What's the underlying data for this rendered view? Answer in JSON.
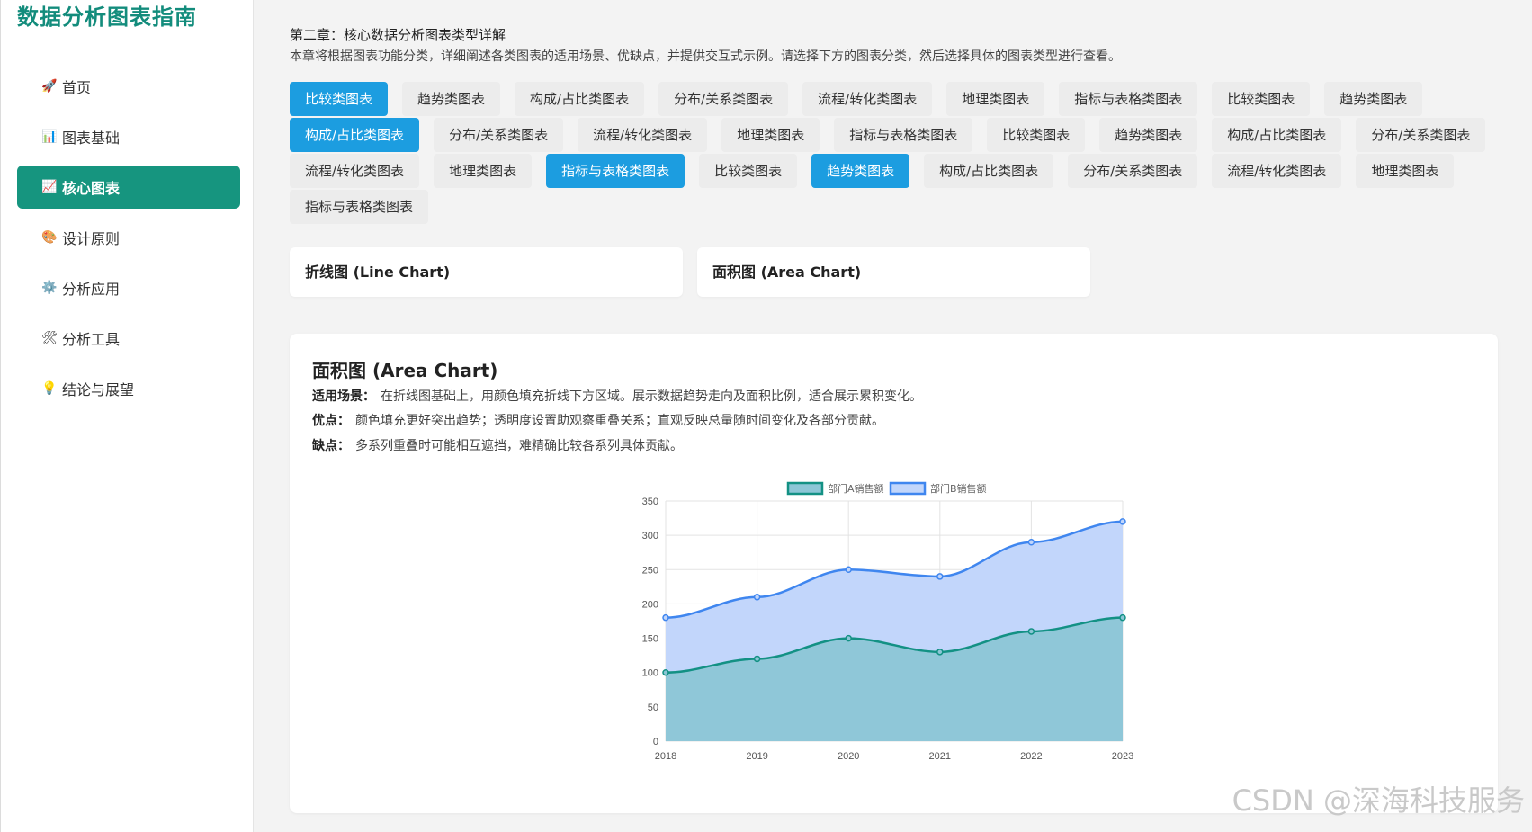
{
  "brand": {
    "title": "数据分析图表指南"
  },
  "nav": [
    {
      "icon": "🚀",
      "label": "首页",
      "active": false
    },
    {
      "icon": "📊",
      "label": "图表基础",
      "active": false
    },
    {
      "icon": "📈",
      "label": "核心图表",
      "active": true
    },
    {
      "icon": "🎨",
      "label": "设计原则",
      "active": false
    },
    {
      "icon": "⚙️",
      "label": "分析应用",
      "active": false
    },
    {
      "icon": "🛠",
      "label": "分析工具",
      "active": false
    },
    {
      "icon": "💡",
      "label": "结论与展望",
      "active": false
    }
  ],
  "chapter": {
    "title": "第二章：核心数据分析图表类型详解",
    "description": "本章将根据图表功能分类，详细阐述各类图表的适用场景、优缺点，并提供交互式示例。请选择下方的图表分类，然后选择具体的图表类型进行查看。"
  },
  "tabs": [
    {
      "label": "比较类图表",
      "active": true
    },
    {
      "label": "趋势类图表",
      "active": false
    },
    {
      "label": "构成/占比类图表",
      "active": false
    },
    {
      "label": "分布/关系类图表",
      "active": false
    },
    {
      "label": "流程/转化类图表",
      "active": false
    },
    {
      "label": "地理类图表",
      "active": false
    },
    {
      "label": "指标与表格类图表",
      "active": false
    },
    {
      "label": "比较类图表",
      "active": false
    },
    {
      "label": "趋势类图表",
      "active": false
    },
    {
      "label": "构成/占比类图表",
      "active": true
    },
    {
      "label": "分布/关系类图表",
      "active": false
    },
    {
      "label": "流程/转化类图表",
      "active": false
    },
    {
      "label": "地理类图表",
      "active": false
    },
    {
      "label": "指标与表格类图表",
      "active": false
    },
    {
      "label": "比较类图表",
      "active": false
    },
    {
      "label": "趋势类图表",
      "active": false
    },
    {
      "label": "构成/占比类图表",
      "active": false
    },
    {
      "label": "分布/关系类图表",
      "active": false
    },
    {
      "label": "流程/转化类图表",
      "active": false
    },
    {
      "label": "地理类图表",
      "active": false
    },
    {
      "label": "指标与表格类图表",
      "active": true
    },
    {
      "label": "比较类图表",
      "active": false
    },
    {
      "label": "趋势类图表",
      "active": true
    },
    {
      "label": "构成/占比类图表",
      "active": false
    },
    {
      "label": "分布/关系类图表",
      "active": false
    },
    {
      "label": "流程/转化类图表",
      "active": false
    },
    {
      "label": "地理类图表",
      "active": false
    },
    {
      "label": "指标与表格类图表",
      "active": false
    }
  ],
  "chart_types": [
    {
      "label": "折线图 (Line Chart)"
    },
    {
      "label": "面积图 (Area Chart)"
    }
  ],
  "detail": {
    "title": "面积图 (Area Chart)",
    "scenario_label": "适用场景：",
    "scenario": "在折线图基础上，用颜色填充折线下方区域。展示数据趋势走向及面积比例，适合展示累积变化。",
    "pros_label": "优点：",
    "pros": "颜色填充更好突出趋势；透明度设置助观察重叠关系；直观反映总量随时间变化及各部分贡献。",
    "cons_label": "缺点：",
    "cons": "多系列重叠时可能相互遮挡，难精确比较各系列具体贡献。"
  },
  "chart_data": {
    "type": "area",
    "x": [
      "2018",
      "2019",
      "2020",
      "2021",
      "2022",
      "2023"
    ],
    "ylim": [
      0,
      350
    ],
    "yticks": [
      0,
      50,
      100,
      150,
      200,
      250,
      300,
      350
    ],
    "grid": true,
    "legend": "top-center",
    "series": [
      {
        "name": "部门A销售额",
        "values": [
          100,
          120,
          150,
          130,
          160,
          180
        ],
        "color": "#139184",
        "fill": "#8cc6d6"
      },
      {
        "name": "部门B销售额",
        "values": [
          180,
          210,
          250,
          240,
          290,
          320
        ],
        "color": "#3f86ef",
        "fill": "#c2d6fb"
      }
    ]
  },
  "watermark": "CSDN @深海科技服务"
}
